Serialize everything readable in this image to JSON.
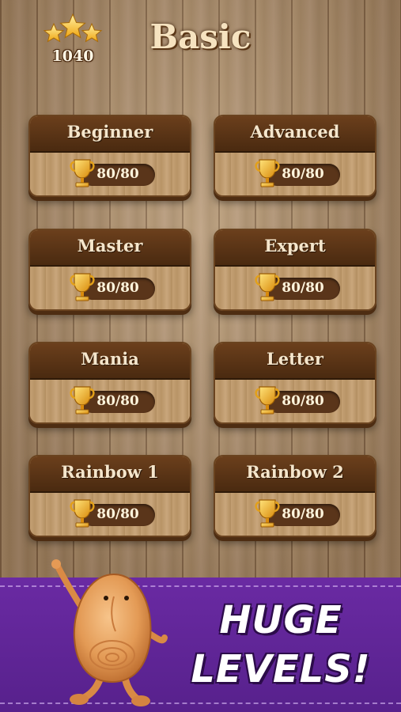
{
  "header": {
    "score": "1040",
    "title": "Basic"
  },
  "levels": [
    {
      "name": "Beginner",
      "progress": "80/80"
    },
    {
      "name": "Advanced",
      "progress": "80/80"
    },
    {
      "name": "Master",
      "progress": "80/80"
    },
    {
      "name": "Expert",
      "progress": "80/80"
    },
    {
      "name": "Mania",
      "progress": "80/80"
    },
    {
      "name": "Letter",
      "progress": "80/80"
    },
    {
      "name": "Rainbow 1",
      "progress": "80/80"
    },
    {
      "name": "Rainbow 2",
      "progress": "80/80"
    }
  ],
  "banner": {
    "line1": "HUGE",
    "line2": "LEVELS!"
  },
  "icons": {
    "stars": "three-stars-icon",
    "trophy": "trophy-icon",
    "mascot": "wooden-mascot"
  },
  "colors": {
    "banner": "#6a2aa3",
    "card_header": "#5a3616",
    "trophy": "#f3b51d"
  }
}
